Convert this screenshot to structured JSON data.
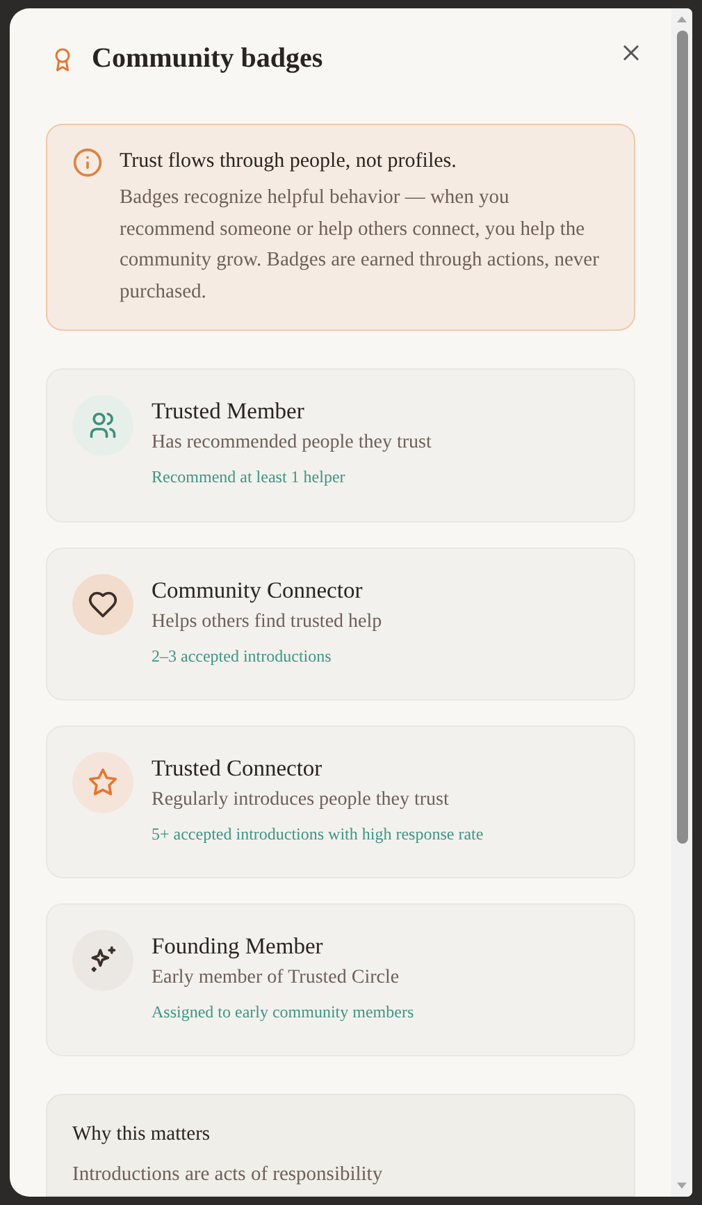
{
  "dialog": {
    "title": "Community badges"
  },
  "notice": {
    "heading": "Trust flows through people, not profiles.",
    "body": "Badges recognize helpful behavior — when you recommend someone or help others connect, you help the community grow. Badges are earned through actions, never purchased."
  },
  "badges": [
    {
      "kind": "people",
      "name": "Trusted Member",
      "description": "Has recommended people they trust",
      "requirement": "Recommend at least 1 helper"
    },
    {
      "kind": "heart",
      "name": "Community Connector",
      "description": "Helps others find trusted help",
      "requirement": "2–3 accepted introductions"
    },
    {
      "kind": "star",
      "name": "Trusted Connector",
      "description": "Regularly introduces people they trust",
      "requirement": "5+ accepted introductions with high response rate"
    },
    {
      "kind": "sparkle",
      "name": "Founding Member",
      "description": "Early member of Trusted Circle",
      "requirement": "Assigned to early community members"
    }
  ],
  "why": {
    "heading": "Why this matters",
    "body": "Introductions are acts of responsibility"
  }
}
